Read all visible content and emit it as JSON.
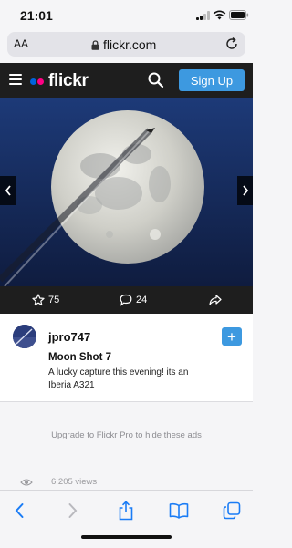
{
  "status_bar": {
    "time": "21:01"
  },
  "browser": {
    "aa_label": "AA",
    "url": "flickr.com"
  },
  "nav": {
    "logo_text": "flickr",
    "signup_label": "Sign Up",
    "colors": {
      "blue_dot": "#0063dc",
      "pink_dot": "#ff0084",
      "accent": "#3d99e0"
    }
  },
  "photo_actions": {
    "faves": "75",
    "comments": "24"
  },
  "details": {
    "owner": "jpro747",
    "follow_label": "+",
    "title": "Moon Shot 7",
    "description": "A lucky capture this evening! its an Iberia A321"
  },
  "ad": {
    "text": "Upgrade to Flickr Pro to hide these ads"
  },
  "stats": {
    "views": "6,205 views"
  },
  "toolbar": {
    "items": [
      "back-icon",
      "forward-icon",
      "share-icon",
      "bookmarks-icon",
      "tabs-icon"
    ]
  }
}
